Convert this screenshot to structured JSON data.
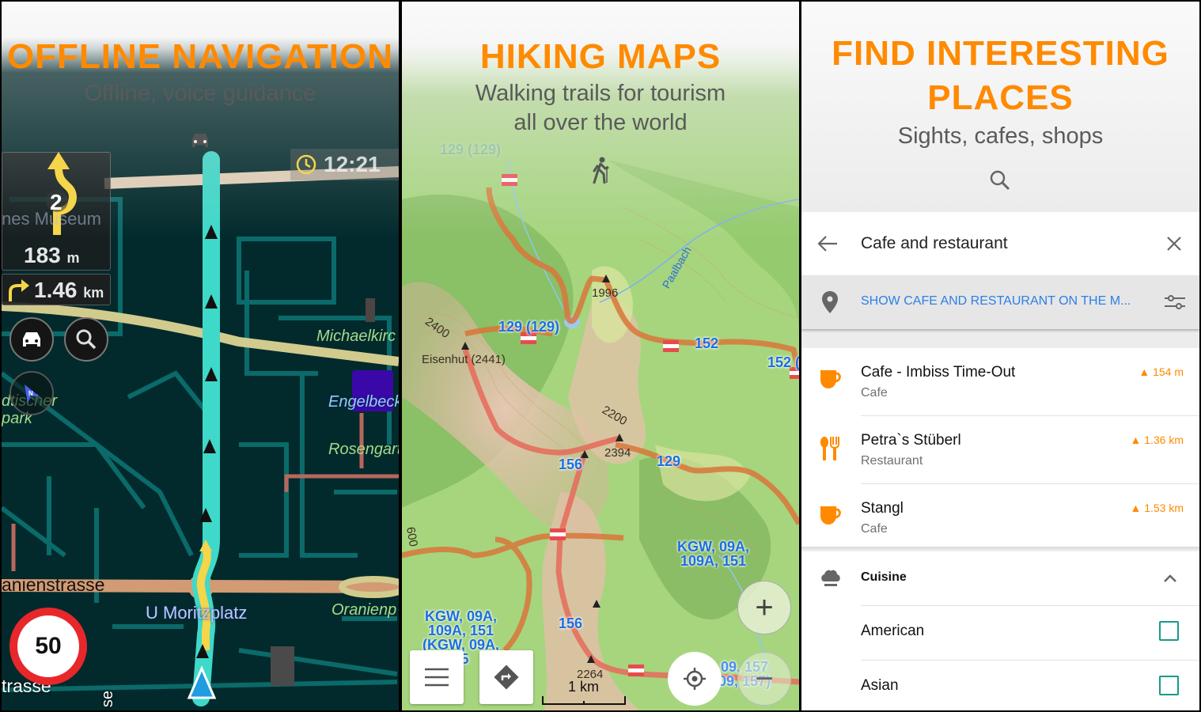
{
  "panels": [
    {
      "title": "OFFLINE NAVIGATION",
      "subtitle": "Offline, voice guidance",
      "mode_icon": "car-icon",
      "turn": {
        "exit_number": "2",
        "distance": "183",
        "distance_unit": "m"
      },
      "next_turn": {
        "distance": "1.46",
        "distance_unit": "km"
      },
      "clock": "12:21",
      "speed_limit": "50",
      "map_labels": {
        "museum": "nes Museum",
        "park": "dtischer",
        "park2": "park",
        "church": "Michaelkirc",
        "station": "Engelbeck",
        "garden": "Rosengart",
        "square": "Oranienp",
        "street1": "anienstrasse",
        "street2": "trasse",
        "street3": "se",
        "stop": "U Moritzplatz"
      },
      "buttons": {
        "car": "car-icon",
        "search": "search-icon",
        "compass": "compass-icon"
      }
    },
    {
      "title": "HIKING MAPS",
      "subtitle_line1": "Walking trails for tourism",
      "subtitle_line2": "all over the world",
      "mode_icon": "hiker-icon",
      "trails": {
        "t1": "129 (129)",
        "t2": "129 (129)",
        "t3": "152",
        "t4": "152 (",
        "t5": "129",
        "t6": "156",
        "t7": "156",
        "t8a": "KGW, 09A,",
        "t8b": "109A, 151",
        "t9a": "KGW, 09A,",
        "t9b": "109A, 151",
        "t9c": "(KGW, 09A,",
        "t9d": "15",
        "t10a": "09, 157",
        "t10b": "09, 157)"
      },
      "peaks": {
        "p1": "Eisenhut (2441)",
        "p2": "1996",
        "p3": "2394",
        "p4": "2264",
        "c1": "2400",
        "c2": "2200",
        "c3": "600"
      },
      "river": "Paalbach",
      "scale": "1 km",
      "zoom_in": "+",
      "zoom_out": "−"
    },
    {
      "title_line1": "FIND INTERESTING",
      "title_line2": "PLACES",
      "subtitle": "Sights, cafes, shops",
      "search": {
        "query": "Cafe and restaurant",
        "show_on_map": "SHOW CAFE AND RESTAURANT ON THE M..."
      },
      "results": [
        {
          "name": "Cafe - Imbiss Time-Out",
          "type": "Cafe",
          "distance": "154 m",
          "icon": "cup-icon"
        },
        {
          "name": "Petra`s Stüberl",
          "type": "Restaurant",
          "distance": "1.36 km",
          "icon": "cutlery-icon"
        },
        {
          "name": "Stangl",
          "type": "Cafe",
          "distance": "1.53 km",
          "icon": "cup-icon"
        }
      ],
      "filter": {
        "label": "Cuisine",
        "options": [
          {
            "label": "American",
            "checked": false
          },
          {
            "label": "Asian",
            "checked": false
          }
        ]
      }
    }
  ],
  "colors": {
    "accent": "#ff8a00",
    "route": "#3fd9c9",
    "link": "#2d7fe8",
    "checkbox": "#189a8a",
    "speed_ring": "#e8272b"
  }
}
